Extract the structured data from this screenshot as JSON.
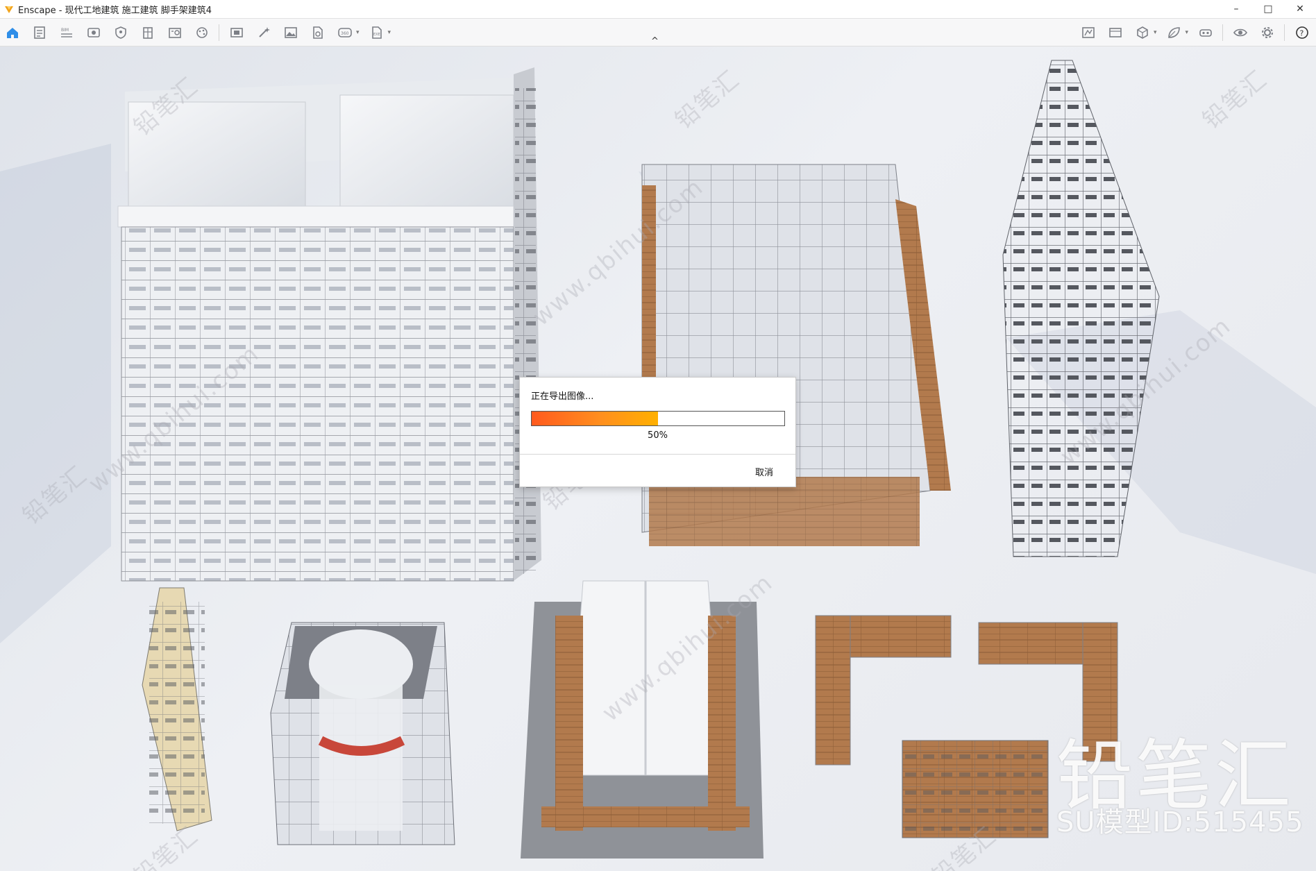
{
  "window": {
    "title": "Enscape - 现代工地建筑 施工建筑 脚手架建筑4",
    "controls": [
      "minimize-icon",
      "maximize-icon",
      "close-icon"
    ]
  },
  "toolbar": {
    "left_icons": [
      "home-icon",
      "document-icon",
      "bim-icon",
      "eye-view-icon",
      "shield-icon",
      "building-icon",
      "info-panel-icon",
      "palette-icon",
      "screenshot-icon",
      "magic-wand-icon",
      "image-icon",
      "export-file-icon",
      "panorama-360-icon",
      "exe-export-icon"
    ],
    "right_icons": [
      "map-icon",
      "view-image-icon",
      "cube-icon",
      "leaf-icon",
      "vr-headset-icon",
      "visibility-icon",
      "settings-icon",
      "help-icon"
    ],
    "labels": {
      "bim": "BIM",
      "panorama": "360",
      "exe": "EXE"
    },
    "collapse_arrow": "^"
  },
  "dialog": {
    "message": "正在导出图像...",
    "progress": 0.5,
    "progress_label": "50%",
    "cancel_label": "取消"
  },
  "watermark": {
    "text_cn": "铅笔汇",
    "text_url": "www.qbihui.com",
    "brand": "铅笔汇",
    "model_id": "SU模型ID:515455"
  },
  "colors": {
    "accent_blue": "#2f8ee8",
    "progress_start": "#ff5a1e",
    "progress_end": "#ffb000",
    "wood": "#b27a4d",
    "title_bg": "#ffffff"
  }
}
